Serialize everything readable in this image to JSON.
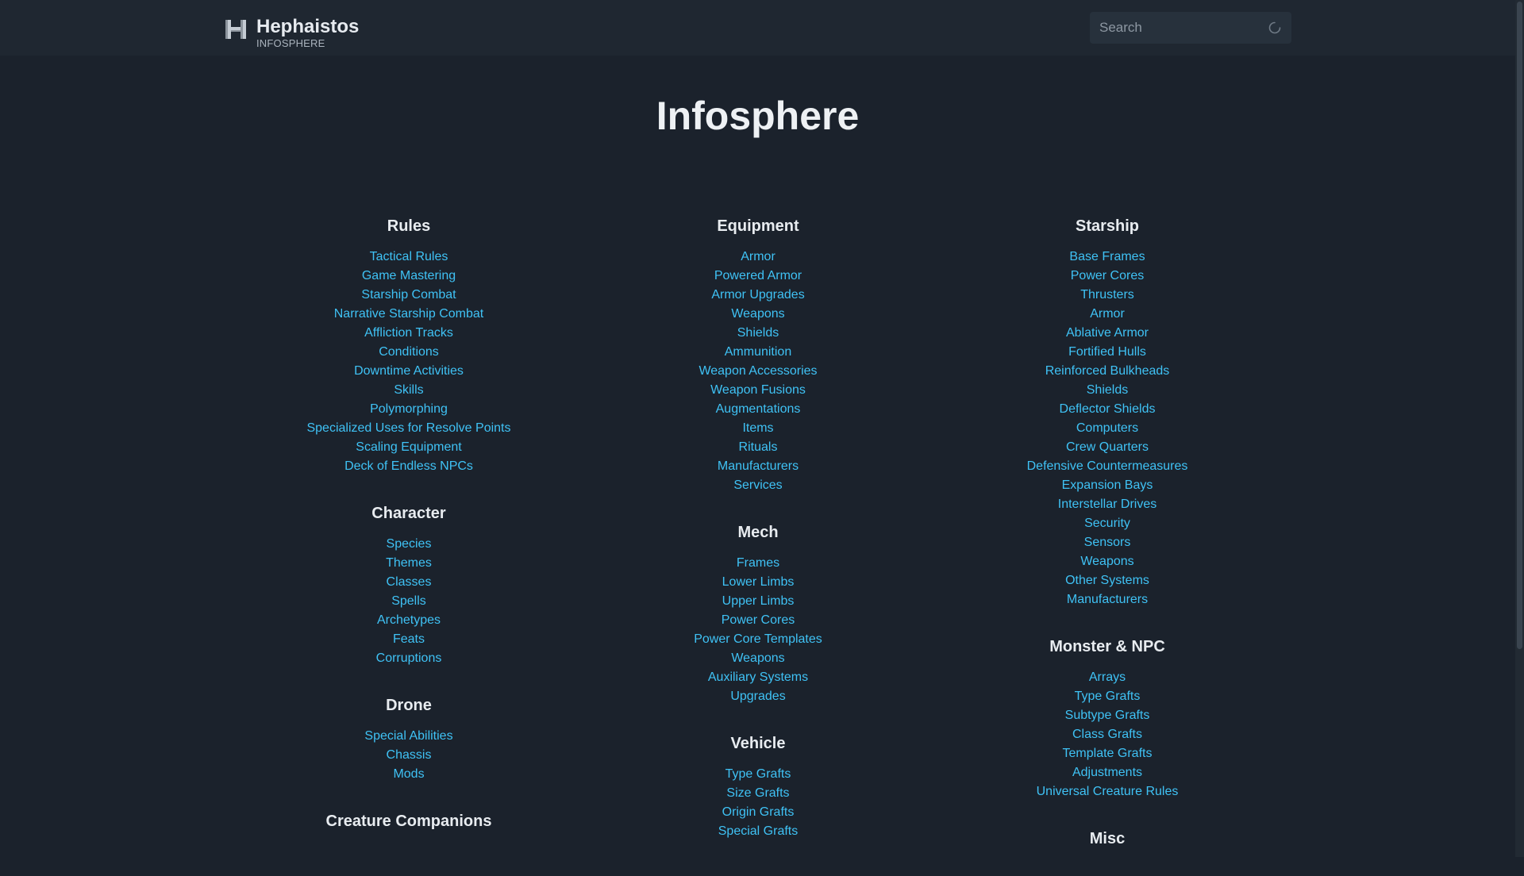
{
  "header": {
    "brand_title": "Hephaistos",
    "brand_subtitle": "INFOSPHERE",
    "brand_icon": "hephaistos-logo-icon",
    "search_placeholder": "Search",
    "search_value": ""
  },
  "page": {
    "title": "Infosphere"
  },
  "colors": {
    "background": "#1b222c",
    "topbar": "#1f2731",
    "link": "#3fc2f5",
    "heading": "#e8ecf0"
  },
  "columns": [
    {
      "sections": [
        {
          "title": "Rules",
          "links": [
            "Tactical Rules",
            "Game Mastering",
            "Starship Combat",
            "Narrative Starship Combat",
            "Affliction Tracks",
            "Conditions",
            "Downtime Activities",
            "Skills",
            "Polymorphing",
            "Specialized Uses for Resolve Points",
            "Scaling Equipment",
            "Deck of Endless NPCs"
          ]
        },
        {
          "title": "Character",
          "links": [
            "Species",
            "Themes",
            "Classes",
            "Spells",
            "Archetypes",
            "Feats",
            "Corruptions"
          ]
        },
        {
          "title": "Drone",
          "links": [
            "Special Abilities",
            "Chassis",
            "Mods"
          ]
        },
        {
          "title": "Creature Companions",
          "links": []
        }
      ]
    },
    {
      "sections": [
        {
          "title": "Equipment",
          "links": [
            "Armor",
            "Powered Armor",
            "Armor Upgrades",
            "Weapons",
            "Shields",
            "Ammunition",
            "Weapon Accessories",
            "Weapon Fusions",
            "Augmentations",
            "Items",
            "Rituals",
            "Manufacturers",
            "Services"
          ]
        },
        {
          "title": "Mech",
          "links": [
            "Frames",
            "Lower Limbs",
            "Upper Limbs",
            "Power Cores",
            "Power Core Templates",
            "Weapons",
            "Auxiliary Systems",
            "Upgrades"
          ]
        },
        {
          "title": "Vehicle",
          "links": [
            "Type Grafts",
            "Size Grafts",
            "Origin Grafts",
            "Special Grafts"
          ]
        }
      ]
    },
    {
      "sections": [
        {
          "title": "Starship",
          "links": [
            "Base Frames",
            "Power Cores",
            "Thrusters",
            "Armor",
            "Ablative Armor",
            "Fortified Hulls",
            "Reinforced Bulkheads",
            "Shields",
            "Deflector Shields",
            "Computers",
            "Crew Quarters",
            "Defensive Countermeasures",
            "Expansion Bays",
            "Interstellar Drives",
            "Security",
            "Sensors",
            "Weapons",
            "Other Systems",
            "Manufacturers"
          ]
        },
        {
          "title": "Monster & NPC",
          "links": [
            "Arrays",
            "Type Grafts",
            "Subtype Grafts",
            "Class Grafts",
            "Template Grafts",
            "Adjustments",
            "Universal Creature Rules"
          ]
        },
        {
          "title": "Misc",
          "links": []
        }
      ]
    }
  ]
}
